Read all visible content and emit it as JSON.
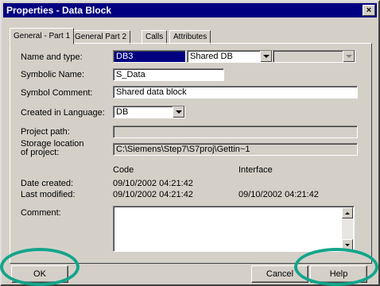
{
  "window": {
    "title": "Properties - Data Block",
    "close": "×"
  },
  "tabs": [
    {
      "label": "General - Part 1"
    },
    {
      "label": "General  Part 2"
    },
    {
      "label": "Calls"
    },
    {
      "label": "Attributes"
    }
  ],
  "form": {
    "name_type_label": "Name and type:",
    "name_value": "DB3",
    "type_value": "Shared DB",
    "type_extra_value": "",
    "symbolic_name_label": "Symbolic Name:",
    "symbolic_name_value": "S_Data",
    "symbol_comment_label": "Symbol Comment:",
    "symbol_comment_value": "Shared data block",
    "language_label": "Created in Language:",
    "language_value": "DB",
    "project_path_label": "Project path:",
    "project_path_value": "",
    "storage_label_1": "Storage location",
    "storage_label_2": "of project:",
    "storage_value": "C:\\Siemens\\Step7\\S7proj\\Gettin~1",
    "col_code": "Code",
    "col_interface": "Interface",
    "date_created_label": "Date created:",
    "date_created_code": "09/10/2002  04:21:42",
    "last_modified_label": "Last modified:",
    "last_modified_code": "09/10/2002  04:21:42",
    "last_modified_interface": "09/10/2002  04:21:42",
    "comment_label": "Comment:",
    "comment_value": ""
  },
  "buttons": {
    "ok": "OK",
    "cancel": "Cancel",
    "help": "Help"
  },
  "colors": {
    "title_bar": "#000080",
    "highlight_circle": "#13a58b",
    "dialog_bg": "#d4d0c8"
  }
}
